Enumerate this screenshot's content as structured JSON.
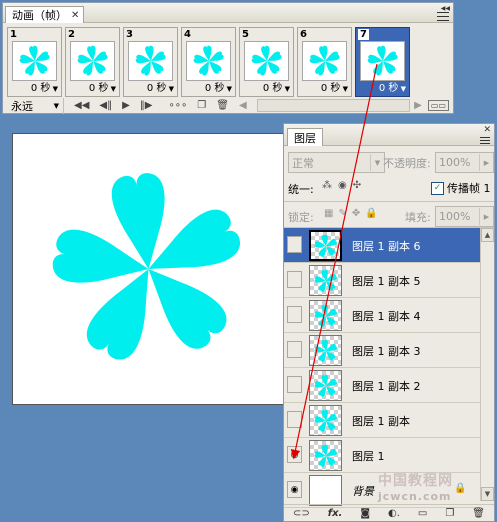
{
  "colors": {
    "flower": "#00eeee",
    "selection": "#3b67b5",
    "arrow": "#dd0000"
  },
  "animation_panel": {
    "tab_label": "动画（帧）",
    "close_icon": "close-icon",
    "frames": [
      {
        "number": "1",
        "delay": "0 秒"
      },
      {
        "number": "2",
        "delay": "0 秒"
      },
      {
        "number": "3",
        "delay": "0 秒"
      },
      {
        "number": "4",
        "delay": "0 秒"
      },
      {
        "number": "5",
        "delay": "0 秒"
      },
      {
        "number": "6",
        "delay": "0 秒"
      },
      {
        "number": "7",
        "delay": "0 秒",
        "selected": true
      }
    ],
    "loop_option": "永远"
  },
  "layers_panel": {
    "tab_label": "图层",
    "blend_mode": "正常",
    "opacity_label": "不透明度:",
    "opacity_value": "100%",
    "unify_label": "统一:",
    "propagate_label": "传播帧 1",
    "propagate_checked": true,
    "lock_label": "锁定:",
    "fill_label": "填充:",
    "fill_value": "100%",
    "layers": [
      {
        "name": "图层 1 副本 6",
        "selected": true,
        "visible": false
      },
      {
        "name": "图层 1 副本 5",
        "selected": false,
        "visible": false
      },
      {
        "name": "图层 1 副本 4",
        "selected": false,
        "visible": false
      },
      {
        "name": "图层 1 副本 3",
        "selected": false,
        "visible": false
      },
      {
        "name": "图层 1 副本 2",
        "selected": false,
        "visible": false
      },
      {
        "name": "图层 1 副本",
        "selected": false,
        "visible": false
      },
      {
        "name": "图层 1",
        "selected": false,
        "visible": true
      },
      {
        "name": "背景",
        "selected": false,
        "visible": true,
        "background": true
      }
    ],
    "bottom_icons": [
      "link-icon",
      "fx-icon",
      "mask-icon",
      "adjustment-icon",
      "folder-icon",
      "new-layer-icon",
      "trash-icon"
    ]
  },
  "watermark": "jcwcn.com"
}
